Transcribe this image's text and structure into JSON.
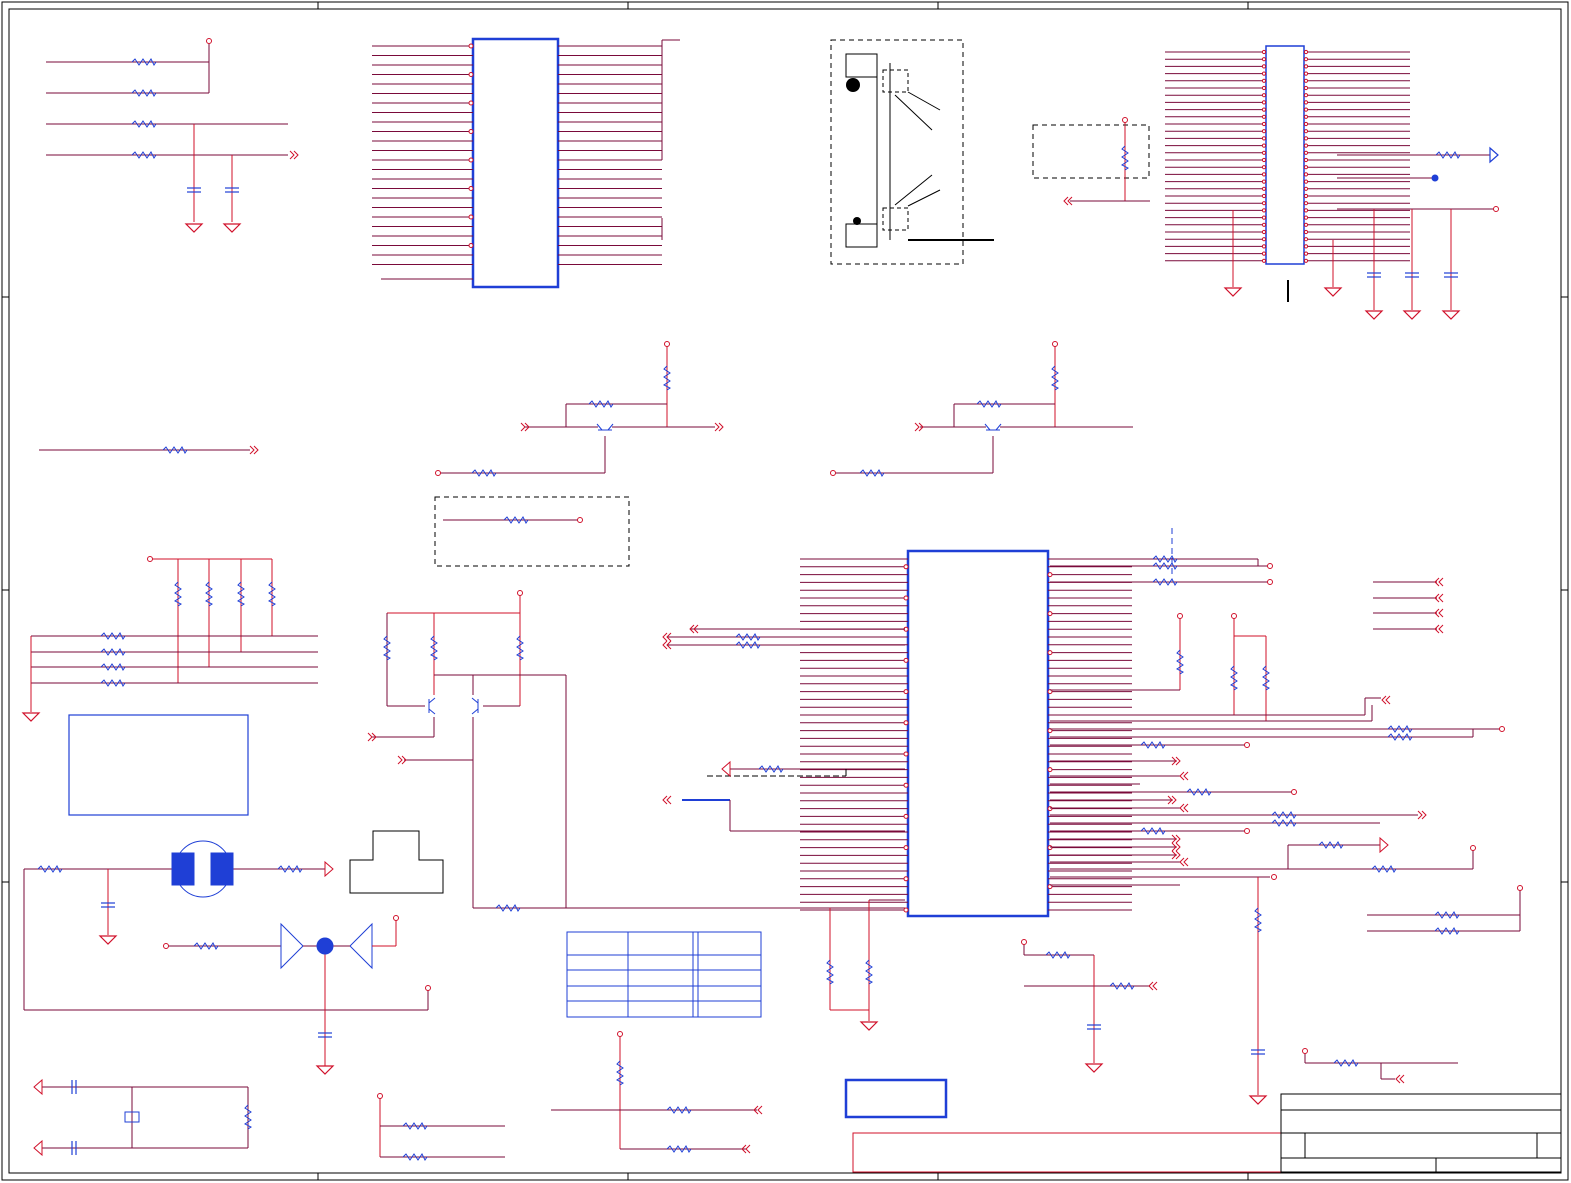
{
  "colors": {
    "wire": "#d0102a",
    "net": "#7a0a3a",
    "component": "#1f3fd6",
    "frame": "#000000",
    "junction": "#c000c0",
    "background": "#ffffff"
  },
  "sheet": {
    "border_ticks_top": 4,
    "border_ticks_side": 3,
    "title_block": "empty",
    "text_labels": []
  },
  "blocks": {
    "top_left_rc": {
      "resistors": 4,
      "capacitors": 2,
      "grounds": 2
    },
    "top_ic": {
      "left_pins": 24,
      "right_pins": 24
    },
    "connector_socket": {
      "outline": "dashed"
    },
    "right_header": {
      "left_pins": 30,
      "right_pins": 30,
      "capacitors": 3
    },
    "transistor_stages": 4,
    "main_ic": {
      "left_pins": 40,
      "right_pins": 40
    },
    "crystal_count": 1,
    "ferrite_count": 1,
    "table": {
      "rows": 5,
      "columns": 3
    }
  }
}
